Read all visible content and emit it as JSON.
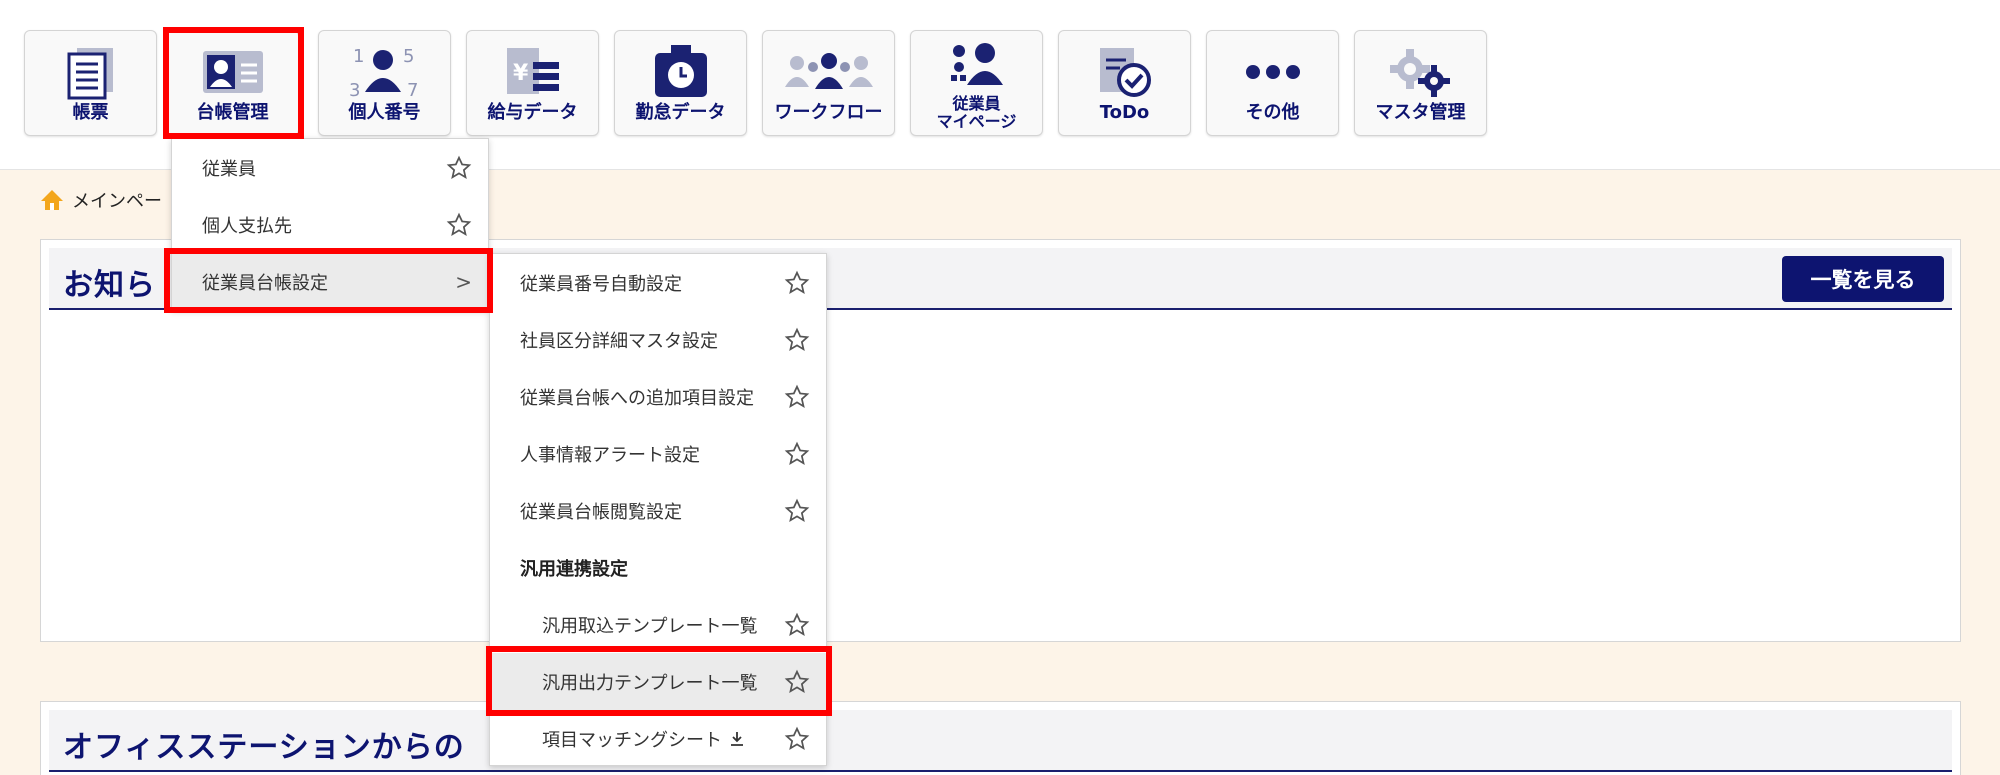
{
  "nav": {
    "tiles": [
      {
        "label": "帳票",
        "icon": "document-stack-icon"
      },
      {
        "label": "台帳管理",
        "icon": "id-card-icon"
      },
      {
        "label": "個人番号",
        "icon": "person-number-icon"
      },
      {
        "label": "給与データ",
        "icon": "yen-document-icon"
      },
      {
        "label": "勤怠データ",
        "icon": "time-clock-icon"
      },
      {
        "label": "ワークフロー",
        "icon": "people-workflow-icon"
      },
      {
        "label": "従業員\nマイページ",
        "label_line1": "従業員",
        "label_line2": "マイページ",
        "icon": "employee-gear-icon"
      },
      {
        "label": "ToDo",
        "icon": "todo-check-icon"
      },
      {
        "label": "その他",
        "icon": "more-dots-icon"
      },
      {
        "label": "マスタ管理",
        "icon": "master-gears-icon"
      }
    ]
  },
  "breadcrumb": {
    "label": "メインペー"
  },
  "notice_panel": {
    "title": "お知ら",
    "view_all": "一覧を見る"
  },
  "office_panel": {
    "title": "オフィスステーションからの"
  },
  "menu_level1": {
    "items": [
      {
        "label": "従業員"
      },
      {
        "label": "個人支払先"
      },
      {
        "label": "従業員台帳設定",
        "chevron": ">"
      }
    ]
  },
  "menu_level2": {
    "items": [
      {
        "label": "従業員番号自動設定"
      },
      {
        "label": "社員区分詳細マスタ設定"
      },
      {
        "label": "従業員台帳への追加項目設定"
      },
      {
        "label": "人事情報アラート設定"
      },
      {
        "label": "従業員台帳閲覧設定"
      },
      {
        "label": "汎用連携設定"
      },
      {
        "label": "汎用取込テンプレート一覧"
      },
      {
        "label": "汎用出力テンプレート一覧"
      },
      {
        "label": "項目マッチングシート"
      }
    ]
  },
  "colors": {
    "navy": "#0d1470",
    "highlight": "#ff0000",
    "background": "#fdf4e8"
  }
}
